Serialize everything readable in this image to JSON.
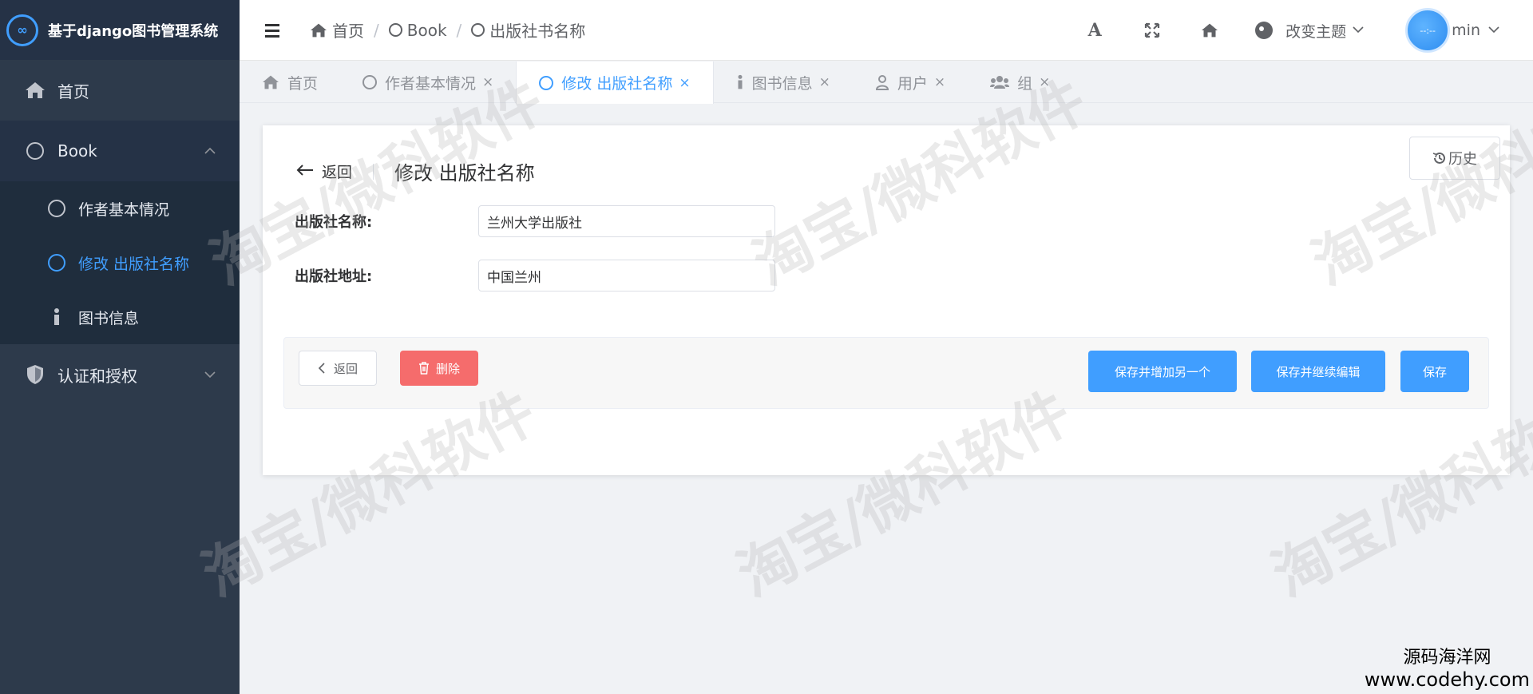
{
  "brand": {
    "logo": "∞",
    "title": "基于django图书管理系统"
  },
  "sidebar": {
    "items": [
      {
        "label": "首页",
        "icon": "home-icon"
      },
      {
        "label": "Book",
        "icon": "circle-icon"
      },
      {
        "label": "认证和授权",
        "icon": "shield-icon"
      }
    ],
    "sub_items": [
      {
        "label": "作者基本情况",
        "icon": "circle-icon"
      },
      {
        "label": "修改 出版社名称",
        "icon": "circle-icon"
      },
      {
        "label": "图书信息",
        "icon": "info-icon"
      }
    ]
  },
  "header": {
    "breadcrumb": [
      "首页",
      "Book",
      "出版社书名称"
    ],
    "separator": "/",
    "theme_label": "改变主题",
    "user_name": "min",
    "avatar_text": "--:--"
  },
  "tabs": [
    {
      "label": "首页",
      "icon": "home-icon",
      "closable": false
    },
    {
      "label": "作者基本情况",
      "icon": "circle-icon",
      "closable": true
    },
    {
      "label": "修改 出版社名称",
      "icon": "circle-icon",
      "closable": true,
      "active": true
    },
    {
      "label": "图书信息",
      "icon": "info-icon",
      "closable": true
    },
    {
      "label": "用户",
      "icon": "user-icon",
      "closable": true
    },
    {
      "label": "组",
      "icon": "group-icon",
      "closable": true
    }
  ],
  "tab_close": "×",
  "main": {
    "history_label": "历史",
    "back_label": "返回",
    "title": "修改 出版社名称",
    "fields": [
      {
        "label": "出版社名称:",
        "value": "兰州大学出版社"
      },
      {
        "label": "出版社地址:",
        "value": "中国兰州"
      }
    ],
    "actions": {
      "back": "返回",
      "delete": "删除",
      "save_add": "保存并增加另一个",
      "save_continue": "保存并继续编辑",
      "save": "保存"
    }
  },
  "watermark": "淘宝/微科软件",
  "site_mark": {
    "line1": "源码海洋网",
    "line2": "www.codehy.com"
  },
  "colors": {
    "sidebar_bg": "#2d3a4b",
    "accent": "#409eff",
    "danger": "#f56c6c"
  }
}
